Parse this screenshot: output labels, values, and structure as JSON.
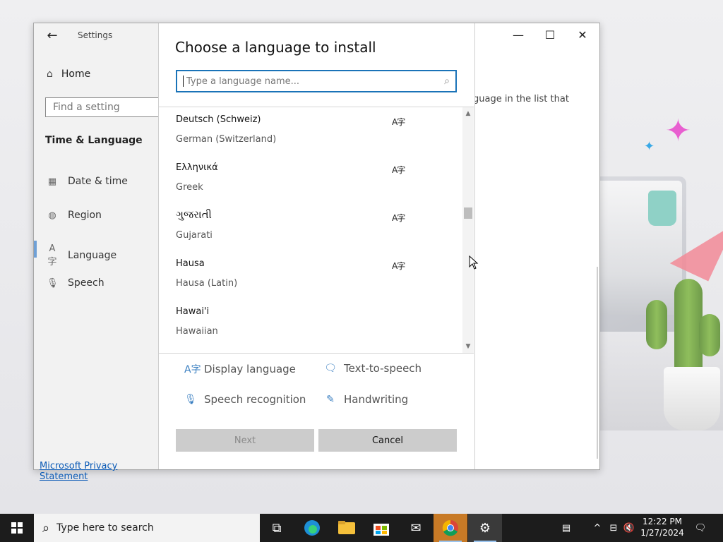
{
  "window": {
    "title": "Settings",
    "back_icon": "back-arrow-icon",
    "controls": {
      "minimize": "—",
      "maximize": "☐",
      "close": "✕"
    }
  },
  "sidebar": {
    "home_label": "Home",
    "search_placeholder": "Find a setting",
    "section_title": "Time & Language",
    "items": [
      {
        "label": "Date & time",
        "icon": "calendar-clock-icon"
      },
      {
        "label": "Region",
        "icon": "globe-icon"
      },
      {
        "label": "Language",
        "icon": "language-icon"
      },
      {
        "label": "Speech",
        "icon": "microphone-icon"
      }
    ],
    "privacy_link": "Microsoft Privacy Statement"
  },
  "background_text": "guage in the list that",
  "dialog": {
    "title": "Choose a language to install",
    "search_placeholder": "Type a language name...",
    "languages": [
      {
        "native": "Deutsch (Schweiz)",
        "english": "German (Switzerland)",
        "display_language": true
      },
      {
        "native": "Ελληνικά",
        "english": "Greek",
        "display_language": true
      },
      {
        "native": "ગુજરાતી",
        "english": "Gujarati",
        "display_language": true
      },
      {
        "native": "Hausa",
        "english": "Hausa (Latin)",
        "display_language": true
      },
      {
        "native": "Hawai'i",
        "english": "Hawaiian",
        "display_language": false
      }
    ],
    "features": [
      {
        "label": "Display language",
        "icon": "display-language-icon"
      },
      {
        "label": "Text-to-speech",
        "icon": "text-to-speech-icon"
      },
      {
        "label": "Speech recognition",
        "icon": "microphone-icon"
      },
      {
        "label": "Handwriting",
        "icon": "handwriting-icon"
      }
    ],
    "next_label": "Next",
    "cancel_label": "Cancel",
    "scroll_position": 0.42
  },
  "taskbar": {
    "search_placeholder": "Type here to search",
    "apps": [
      "task-view-icon",
      "edge-icon",
      "file-explorer-icon",
      "store-icon",
      "mail-icon",
      "chrome-icon",
      "settings-icon"
    ],
    "clock_time": "12:22 PM",
    "clock_date": "1/27/2024"
  },
  "colors": {
    "accent": "#1a73b8",
    "taskbar": "#1c1c1c",
    "nav_accent": "#6fa0d6"
  }
}
